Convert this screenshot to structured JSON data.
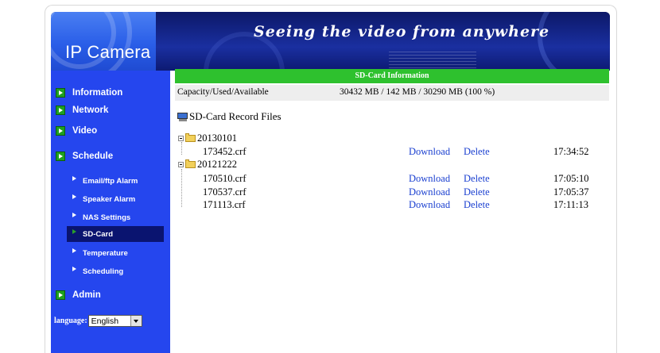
{
  "header": {
    "brand": "IP Camera",
    "slogan": "Seeing the video from anywhere"
  },
  "sidebar": {
    "main_items": [
      {
        "label": "Information"
      },
      {
        "label": "Network"
      },
      {
        "label": "Video"
      },
      {
        "label": "Schedule"
      }
    ],
    "sub_items": [
      {
        "label": "Email/ftp Alarm"
      },
      {
        "label": "Speaker Alarm"
      },
      {
        "label": "NAS Settings"
      },
      {
        "label": "SD-Card",
        "active": true
      },
      {
        "label": "Temperature"
      },
      {
        "label": "Scheduling"
      }
    ],
    "admin_label": "Admin",
    "language_label": "language:",
    "language_value": "English"
  },
  "sdcard": {
    "section_title": "SD-Card Information",
    "capacity_label": "Capacity/Used/Available",
    "capacity_value": "30432 MB / 142 MB / 30290 MB (100 %)",
    "records_title": "SD-Card Record Files",
    "folders": [
      {
        "name": "20130101",
        "files": [
          {
            "name": "173452.crf",
            "download": "Download",
            "delete": "Delete",
            "time": "17:34:52"
          }
        ]
      },
      {
        "name": "20121222",
        "files": [
          {
            "name": "170510.crf",
            "download": "Download",
            "delete": "Delete",
            "time": "17:05:10"
          },
          {
            "name": "170537.crf",
            "download": "Download",
            "delete": "Delete",
            "time": "17:05:37"
          },
          {
            "name": "171113.crf",
            "download": "Download",
            "delete": "Delete",
            "time": "17:11:13"
          }
        ]
      }
    ]
  },
  "colors": {
    "sidebar": "#2546ee",
    "section_bar": "#2ec12e",
    "link": "#1a3fd0"
  }
}
